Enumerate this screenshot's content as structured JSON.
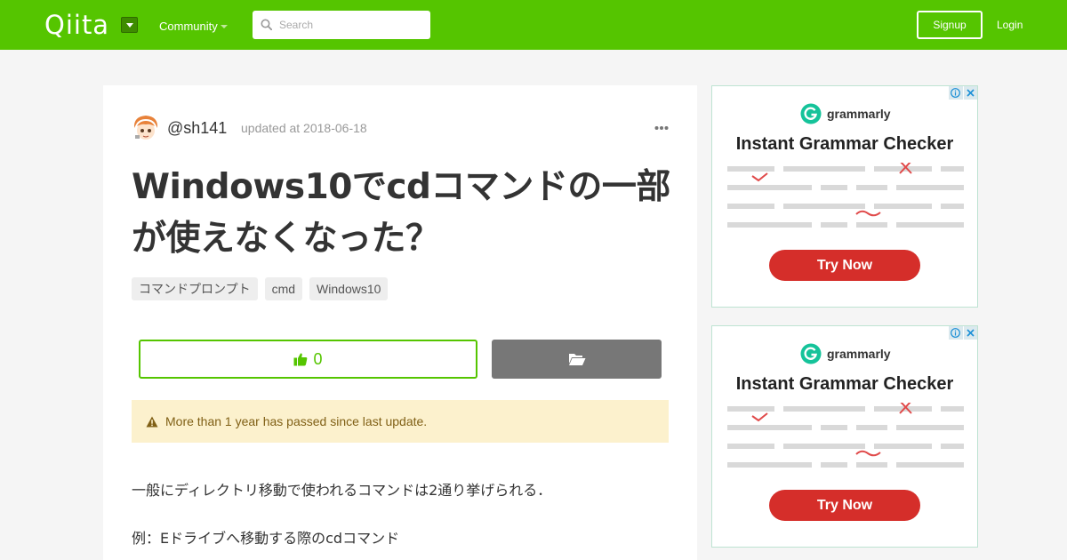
{
  "header": {
    "logo": "Qiita",
    "community_label": "Community",
    "search_placeholder": "Search",
    "signup_label": "Signup",
    "login_label": "Login",
    "brand_color": "#55c500"
  },
  "article": {
    "author": "@sh141",
    "updated": "updated at 2018-06-18",
    "title": "Windows10でcdコマンドの一部が使えなくなった？",
    "tags": [
      "コマンドプロンプト",
      "cmd",
      "Windows10"
    ],
    "likes": "0",
    "notice": "More than 1 year has passed since last update.",
    "paragraphs": [
      "一般にディレクトリ移動で使われるコマンドは2通り挙げられる．",
      "例：Eドライブへ移動する際のcdコマンド"
    ]
  },
  "ads": [
    {
      "brand": "grammarly",
      "headline": "Instant Grammar Checker",
      "cta": "Try Now"
    },
    {
      "brand": "grammarly",
      "headline": "Instant Grammar Checker",
      "cta": "Try Now"
    }
  ]
}
